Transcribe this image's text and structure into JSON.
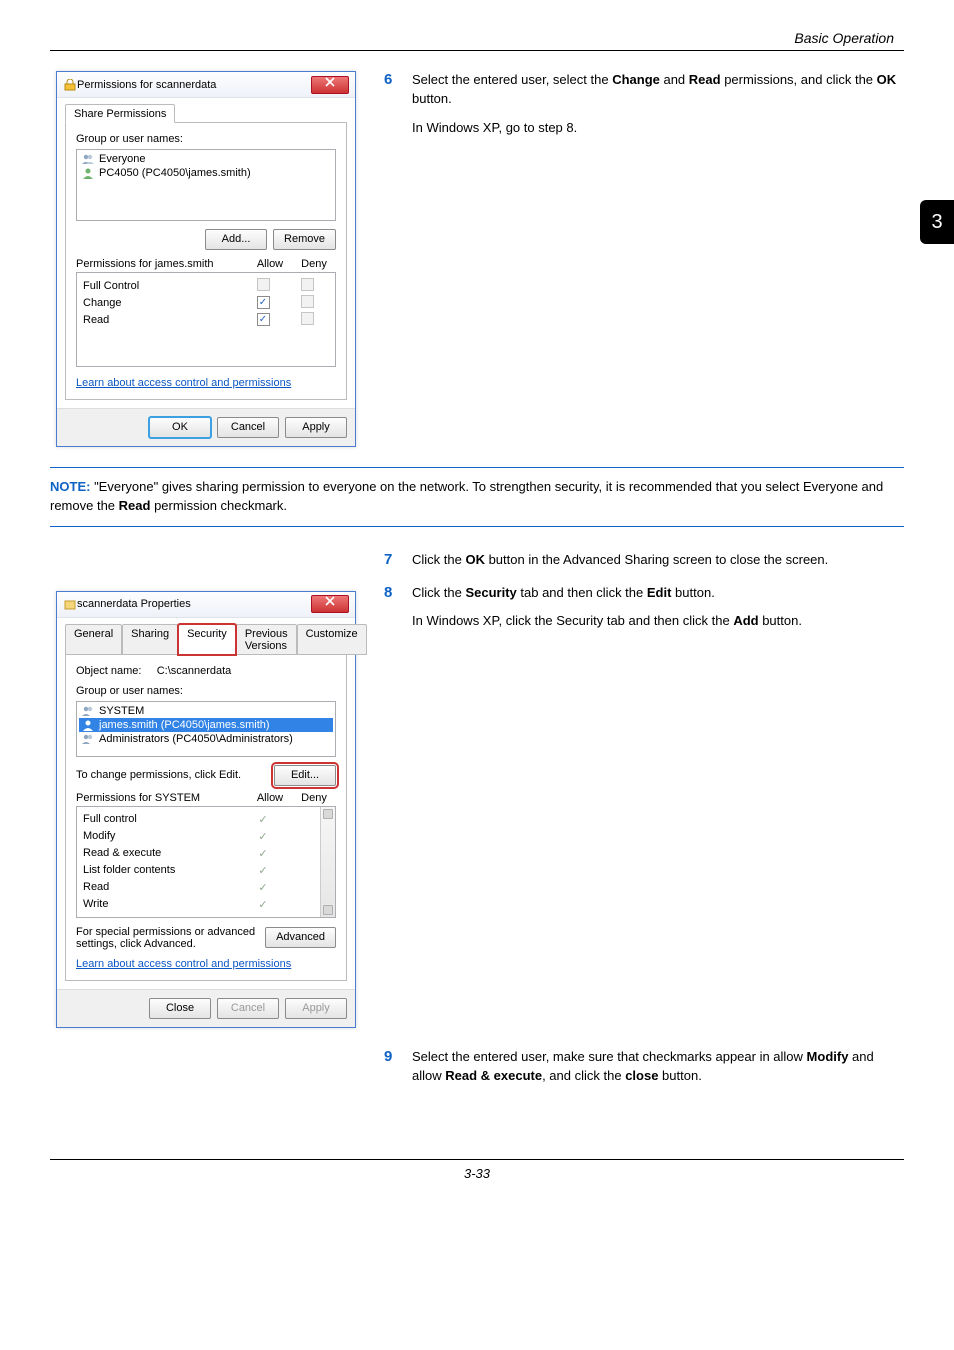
{
  "header": {
    "section": "Basic Operation"
  },
  "chapter_tab": "3",
  "footer": {
    "page": "3-33"
  },
  "step6": {
    "num": "6",
    "text_before_change": "Select the entered user, select the ",
    "bold_change": "Change",
    "text_mid": " and ",
    "bold_read": "Read",
    "text_after": " permissions, and click the ",
    "bold_ok": "OK",
    "text_end": " button.",
    "sub": "In Windows XP, go to step 8."
  },
  "note": {
    "label": "NOTE:",
    "text_a": " \"Everyone\" gives sharing permission to everyone on the network. To strengthen security, it is recommended that you select Everyone and remove the ",
    "bold_read": "Read",
    "text_b": " permission checkmark."
  },
  "step7": {
    "num": "7",
    "a": "Click the ",
    "bold_ok": "OK",
    "b": " button in the Advanced Sharing screen to close the screen."
  },
  "step8": {
    "num": "8",
    "a": "Click the ",
    "bold_security": "Security",
    "b": " tab and then click the ",
    "bold_edit": "Edit",
    "c": " button.",
    "sub_a": "In Windows XP, click the Security tab and then click the ",
    "bold_add": "Add",
    "sub_b": " button."
  },
  "step9": {
    "num": "9",
    "a": "Select the entered user, make sure that checkmarks appear in allow ",
    "bold_modify": "Modify",
    "b": " and allow ",
    "bold_re": "Read & execute",
    "c": ", and click the ",
    "bold_close": "close",
    "d": " button."
  },
  "dialog1": {
    "title": "Permissions for scannerdata",
    "tab": "Share Permissions",
    "group_label": "Group or user names:",
    "list": [
      {
        "name": "Everyone"
      },
      {
        "name": "PC4050 (PC4050\\james.smith)"
      }
    ],
    "btn_add": "Add...",
    "btn_remove": "Remove",
    "perm_for": "Permissions for james.smith",
    "col_allow": "Allow",
    "col_deny": "Deny",
    "rows": [
      {
        "label": "Full Control",
        "allow": false,
        "deny": false
      },
      {
        "label": "Change",
        "allow": true,
        "deny": false
      },
      {
        "label": "Read",
        "allow": true,
        "deny": false
      }
    ],
    "link": "Learn about access control and permissions",
    "btn_ok": "OK",
    "btn_cancel": "Cancel",
    "btn_apply": "Apply"
  },
  "dialog2": {
    "title": "scannerdata Properties",
    "tabs": {
      "general": "General",
      "sharing": "Sharing",
      "security": "Security",
      "prev": "Previous Versions",
      "custom": "Customize"
    },
    "object_label": "Object name:",
    "object_value": "C:\\scannerdata",
    "group_label": "Group or user names:",
    "list": [
      {
        "name": "SYSTEM",
        "sel": false,
        "icon": "group"
      },
      {
        "name": "james.smith (PC4050\\james.smith)",
        "sel": true,
        "icon": "user"
      },
      {
        "name": "Administrators (PC4050\\Administrators)",
        "sel": false,
        "icon": "group"
      }
    ],
    "change_text": "To change permissions, click Edit.",
    "btn_edit": "Edit...",
    "perm_for": "Permissions for SYSTEM",
    "col_allow": "Allow",
    "col_deny": "Deny",
    "rows": [
      {
        "label": "Full control",
        "allow": true
      },
      {
        "label": "Modify",
        "allow": true
      },
      {
        "label": "Read & execute",
        "allow": true
      },
      {
        "label": "List folder contents",
        "allow": true
      },
      {
        "label": "Read",
        "allow": true
      },
      {
        "label": "Write",
        "allow": true
      }
    ],
    "adv_text": "For special permissions or advanced settings, click Advanced.",
    "btn_adv": "Advanced",
    "link": "Learn about access control and permissions",
    "btn_close": "Close",
    "btn_cancel": "Cancel",
    "btn_apply": "Apply"
  }
}
